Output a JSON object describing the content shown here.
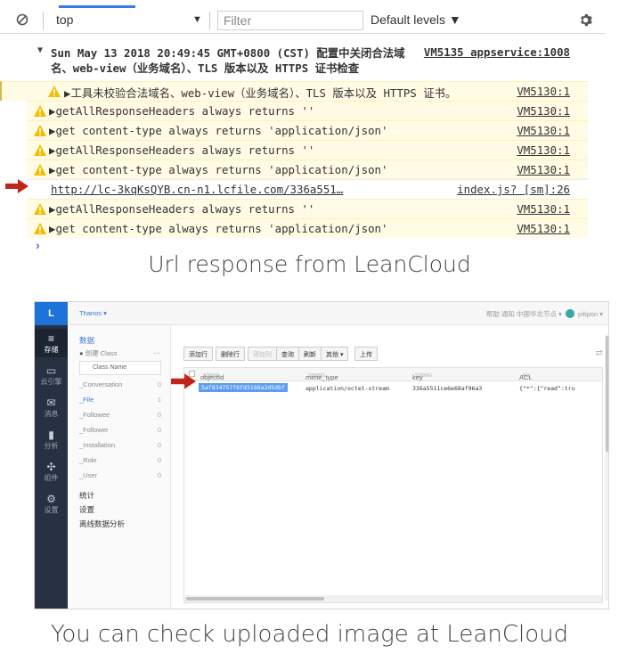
{
  "console": {
    "context": "top",
    "filter_placeholder": "Filter",
    "levels": "Default levels ▼",
    "rows": [
      {
        "text_line1": "Sun May 13 2018 20:49:45 GMT+0800 (CST) 配置中关闭合法域",
        "text_line2": "名、web-view（业务域名）、TLS 版本以及 HTTPS 证书检查",
        "source": "VM5135 appservice:1008"
      },
      {
        "text": "▶工具未校验合法域名、web-view（业务域名）、TLS 版本以及 HTTPS 证书。",
        "source": "VM5130:1"
      },
      {
        "text": "▶getAllResponseHeaders always returns ''",
        "source": "VM5130:1"
      },
      {
        "text": "▶get content-type always returns 'application/json'",
        "source": "VM5130:1"
      },
      {
        "text": "▶getAllResponseHeaders always returns ''",
        "source": "VM5130:1"
      },
      {
        "text": "▶get content-type always returns 'application/json'",
        "source": "VM5130:1"
      },
      {
        "text": "http://lc-3kqKsQYB.cn-n1.lcfile.com/336a551…",
        "source": "index.js? [sm]:26"
      },
      {
        "text": "▶getAllResponseHeaders always returns ''",
        "source": "VM5130:1"
      },
      {
        "text": "▶get content-type always returns 'application/json'",
        "source": "VM5130:1"
      }
    ],
    "prompt": "›"
  },
  "captions": {
    "top": "Url response from LeanCloud",
    "bottom": "You can check uploaded image at LeanCloud"
  },
  "leancloud": {
    "logo": "L",
    "app_name": "Thanos ▾",
    "top_right": "帮助   通知   中国华北节点 ▾",
    "user": "pitipon ▾",
    "sidebar": [
      {
        "icon": "≡",
        "label": "存储"
      },
      {
        "icon": "▭",
        "label": "云引擎"
      },
      {
        "icon": "✉",
        "label": "消息"
      },
      {
        "icon": "▮",
        "label": "分析"
      },
      {
        "icon": "✣",
        "label": "组件"
      },
      {
        "icon": "⚙",
        "label": "设置"
      }
    ],
    "nav": {
      "section": "数据",
      "create": "创建 Class",
      "more": "···",
      "class_name": "Class Name",
      "classes": [
        {
          "name": "_Conversation",
          "count": "0"
        },
        {
          "name": "_File",
          "count": "1"
        },
        {
          "name": "_Followee",
          "count": "0"
        },
        {
          "name": "_Follower",
          "count": "0"
        },
        {
          "name": "_Installation",
          "count": "0"
        },
        {
          "name": "_Role",
          "count": "0"
        },
        {
          "name": "_User",
          "count": "0"
        }
      ],
      "links": [
        "统计",
        "设置",
        "离线数据分析"
      ]
    },
    "toolbar": [
      "添加行",
      "删除行",
      "添加列",
      "查询",
      "刷新",
      "其他 ▾",
      "上传"
    ],
    "columns": [
      {
        "name": "objectId",
        "type": "STRING"
      },
      {
        "name": "mime_type",
        "type": "STRING"
      },
      {
        "name": "key",
        "type": "STRING"
      },
      {
        "name": "ACL",
        "type": "ACL"
      }
    ],
    "row": {
      "objectId": "5af834757f6fd3188a2d5dbf",
      "mime_type": "application/octet-stream",
      "key": "336a5511ce6e68af96a3",
      "acl": "{\"*\":{\"read\":tru"
    }
  },
  "colors": {
    "warning_bg": "#fffbe5",
    "accent": "#3b78e7",
    "arrow": "#c0251c",
    "sidebar": "#273142"
  }
}
